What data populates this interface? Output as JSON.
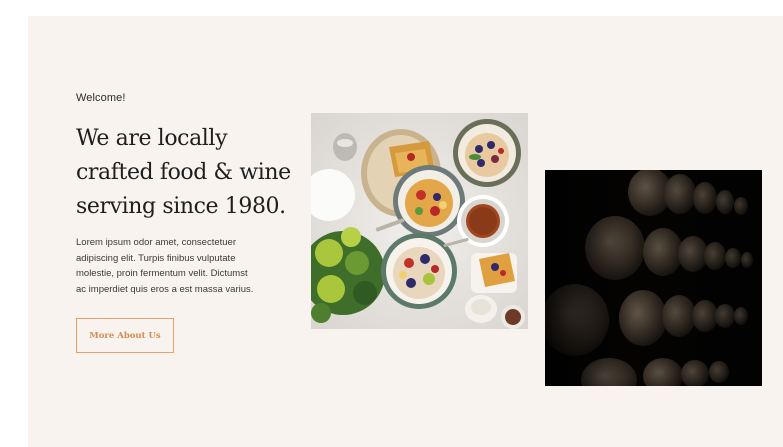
{
  "hero": {
    "welcome": "Welcome!",
    "headline_lines": [
      "We are locally",
      "crafted food & wine",
      "serving since 1980."
    ],
    "body_lines": [
      "Lorem ipsum odor amet, consectetuer",
      "adipiscing elit. Turpis finibus vulputate",
      "molestie, proin fermentum velit. Dictumst",
      "ac imperdiet quis eros a est massa varius."
    ],
    "button_label": "More About Us",
    "button_color": "#e8a06a",
    "background_color": "#f8f3ee"
  }
}
